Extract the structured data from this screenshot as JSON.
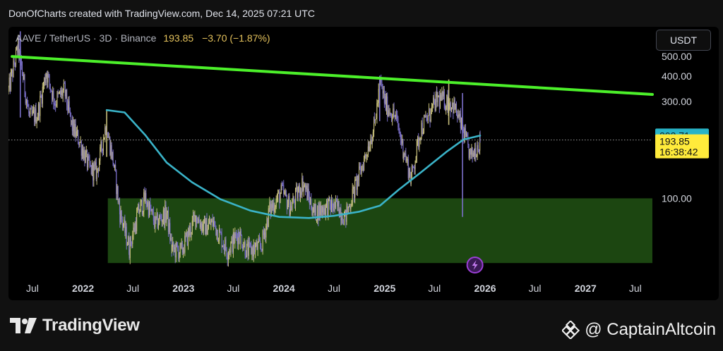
{
  "header": {
    "created_by": "DonOfCharts created with TradingView.com, Dec 14, 2025 07:21 UTC"
  },
  "symbol": {
    "description": "AAVE / TetherUS · 3D · Binance",
    "price": "193.85",
    "change": "−3.70 (−1.87%)"
  },
  "currency_button": "USDT",
  "price_tags": {
    "ma_value": "203.71",
    "last_price": "193.85",
    "countdown": "16:38:42"
  },
  "footer": {
    "brand": "TradingView",
    "watermark": "@ CaptainAltcoin"
  },
  "colors": {
    "background": "#000000",
    "candle_up": "#c8c07c",
    "candle_down": "#7b6fc9",
    "trendline": "#4cf02a",
    "moving_average": "#3ab3c8",
    "support_zone": "#1e4a12",
    "price_tag_bg": "#ffeb3b",
    "ma_tag_bg": "#28b3c7",
    "event_icon": "#9b3fd6"
  },
  "chart_data": {
    "type": "candlestick",
    "title": "AAVE / TetherUS · 3D · Binance",
    "y_scale": "log",
    "ylim": [
      40,
      700
    ],
    "xlim": [
      "2021-04-05",
      "2027-09-01"
    ],
    "y_ticks": [
      {
        "value": 100,
        "label": "100.00"
      },
      {
        "value": 300,
        "label": "300.00"
      },
      {
        "value": 400,
        "label": "400.00"
      },
      {
        "value": 500,
        "label": "500.00"
      }
    ],
    "x_ticks": [
      {
        "date": "2021-07-01",
        "label": "Jul"
      },
      {
        "date": "2022-01-01",
        "label": "2022"
      },
      {
        "date": "2022-07-01",
        "label": "Jul"
      },
      {
        "date": "2023-01-01",
        "label": "2023"
      },
      {
        "date": "2023-07-01",
        "label": "Jul"
      },
      {
        "date": "2024-01-01",
        "label": "2024"
      },
      {
        "date": "2024-07-01",
        "label": "Jul"
      },
      {
        "date": "2025-01-01",
        "label": "2025"
      },
      {
        "date": "2025-07-01",
        "label": "Jul"
      },
      {
        "date": "2026-01-01",
        "label": "2026"
      },
      {
        "date": "2026-07-01",
        "label": "Jul"
      },
      {
        "date": "2027-01-01",
        "label": "2027"
      },
      {
        "date": "2027-07-01",
        "label": "Jul"
      }
    ],
    "price_path": [
      [
        "2021-04-05",
        340
      ],
      [
        "2021-05-10",
        560
      ],
      [
        "2021-06-20",
        250
      ],
      [
        "2021-07-20",
        260
      ],
      [
        "2021-08-20",
        420
      ],
      [
        "2021-09-20",
        300
      ],
      [
        "2021-10-25",
        340
      ],
      [
        "2021-11-20",
        230
      ],
      [
        "2021-12-20",
        190
      ],
      [
        "2022-01-25",
        140
      ],
      [
        "2022-02-20",
        135
      ],
      [
        "2022-03-25",
        230
      ],
      [
        "2022-04-20",
        155
      ],
      [
        "2022-05-15",
        85
      ],
      [
        "2022-06-18",
        57
      ],
      [
        "2022-07-20",
        85
      ],
      [
        "2022-08-15",
        100
      ],
      [
        "2022-09-20",
        75
      ],
      [
        "2022-11-01",
        85
      ],
      [
        "2022-11-20",
        56
      ],
      [
        "2022-12-25",
        55
      ],
      [
        "2023-02-15",
        82
      ],
      [
        "2023-03-15",
        72
      ],
      [
        "2023-04-20",
        76
      ],
      [
        "2023-06-10",
        55
      ],
      [
        "2023-07-20",
        68
      ],
      [
        "2023-08-20",
        55
      ],
      [
        "2023-10-10",
        58
      ],
      [
        "2023-11-10",
        88
      ],
      [
        "2023-12-25",
        108
      ],
      [
        "2024-01-25",
        90
      ],
      [
        "2024-03-10",
        120
      ],
      [
        "2024-04-20",
        85
      ],
      [
        "2024-06-10",
        92
      ],
      [
        "2024-07-20",
        90
      ],
      [
        "2024-08-10",
        80
      ],
      [
        "2024-10-15",
        150
      ],
      [
        "2024-11-25",
        230
      ],
      [
        "2024-12-16",
        370
      ],
      [
        "2025-01-05",
        290
      ],
      [
        "2025-02-10",
        250
      ],
      [
        "2025-03-10",
        175
      ],
      [
        "2025-04-07",
        125
      ],
      [
        "2025-05-12",
        220
      ],
      [
        "2025-06-15",
        260
      ],
      [
        "2025-07-10",
        310
      ],
      [
        "2025-08-20",
        300
      ],
      [
        "2025-09-10",
        285
      ],
      [
        "2025-10-10",
        220
      ],
      [
        "2025-11-10",
        160
      ],
      [
        "2025-12-14",
        193.85
      ]
    ],
    "highlighted_candles": [
      {
        "date": "2021-05-18",
        "high": 665,
        "low": 250
      },
      {
        "date": "2022-03-28",
        "high": 272,
        "low": 160
      },
      {
        "date": "2024-12-14",
        "high": 402,
        "low": 240
      },
      {
        "date": "2025-08-22",
        "high": 385,
        "low": 230
      },
      {
        "date": "2025-10-11",
        "high": 330,
        "low": 81
      }
    ],
    "moving_average": [
      [
        "2022-03-28",
        272
      ],
      [
        "2022-06-01",
        265
      ],
      [
        "2022-08-15",
        205
      ],
      [
        "2022-11-01",
        150
      ],
      [
        "2023-02-01",
        120
      ],
      [
        "2023-05-15",
        99
      ],
      [
        "2023-09-01",
        87
      ],
      [
        "2023-12-15",
        81
      ],
      [
        "2024-04-01",
        80
      ],
      [
        "2024-07-01",
        82
      ],
      [
        "2024-10-01",
        86
      ],
      [
        "2024-12-15",
        92
      ],
      [
        "2025-02-20",
        110
      ],
      [
        "2025-05-15",
        135
      ],
      [
        "2025-08-15",
        170
      ],
      [
        "2025-10-15",
        195
      ],
      [
        "2025-12-14",
        203.71
      ]
    ],
    "trendline": {
      "start": {
        "date": "2021-04-18",
        "value": 500
      },
      "end": {
        "date": "2027-09-01",
        "value": 325
      }
    },
    "support_zone": {
      "start": "2022-04-01",
      "end": "2027-09-01",
      "low": 48,
      "high": 100
    },
    "last_price": 193.85,
    "ma_value": 203.71
  }
}
